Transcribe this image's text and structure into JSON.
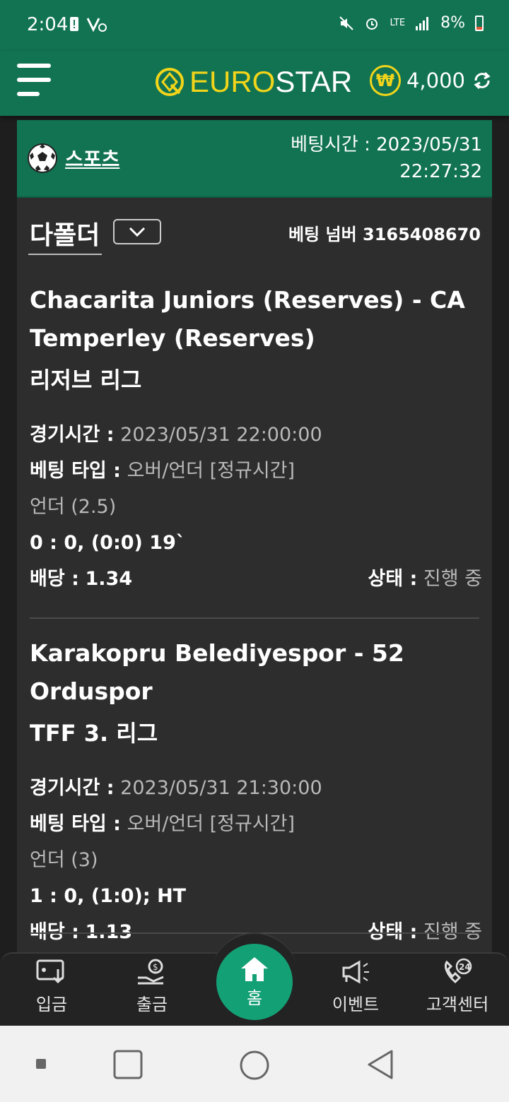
{
  "status_bar": {
    "time": "2:04",
    "battery": "8%",
    "network": "LTE"
  },
  "header": {
    "logo_euro": "EURO",
    "logo_star": "STAR",
    "balance": "4,000",
    "currency_symbol": "₩"
  },
  "sport_bar": {
    "label": "스포츠",
    "bet_time_label": "베팅시간 : 2023/05/31",
    "bet_time_clock": "22:27:32"
  },
  "bet": {
    "type_label": "다폴더",
    "bet_number": "베팅 넘버 3165408670"
  },
  "labels": {
    "game_time": "경기시간 :",
    "bet_type": "베팅 타입 :",
    "odds": "배당 :",
    "status": "상태 :"
  },
  "matches": [
    {
      "title": "Chacarita Juniors (Reserves) - CA Temperley (Reserves)",
      "league": "리저브 리그",
      "game_time": "2023/05/31 22:00:00",
      "bet_type": "오버/언더 [정규시간]",
      "selection": "언더 (2.5)",
      "score": "0 : 0, (0:0) 19`",
      "odds": "1.34",
      "status": "진행 중"
    },
    {
      "title": "Karakopru Belediyespor - 52 Orduspor",
      "league": "TFF 3. 리그",
      "game_time": "2023/05/31 21:30:00",
      "bet_type": "오버/언더 [정규시간]",
      "selection": "언더 (3)",
      "score": "1 : 0, (1:0); HT",
      "odds": "1.13",
      "status": "진행 중"
    }
  ],
  "bottom_nav": {
    "deposit": "입금",
    "withdraw": "출금",
    "home": "홈",
    "event": "이벤트",
    "support": "고객센터"
  },
  "colors": {
    "brand_green": "#127352",
    "accent_yellow": "#f2d51a",
    "home_green": "#14a075"
  }
}
